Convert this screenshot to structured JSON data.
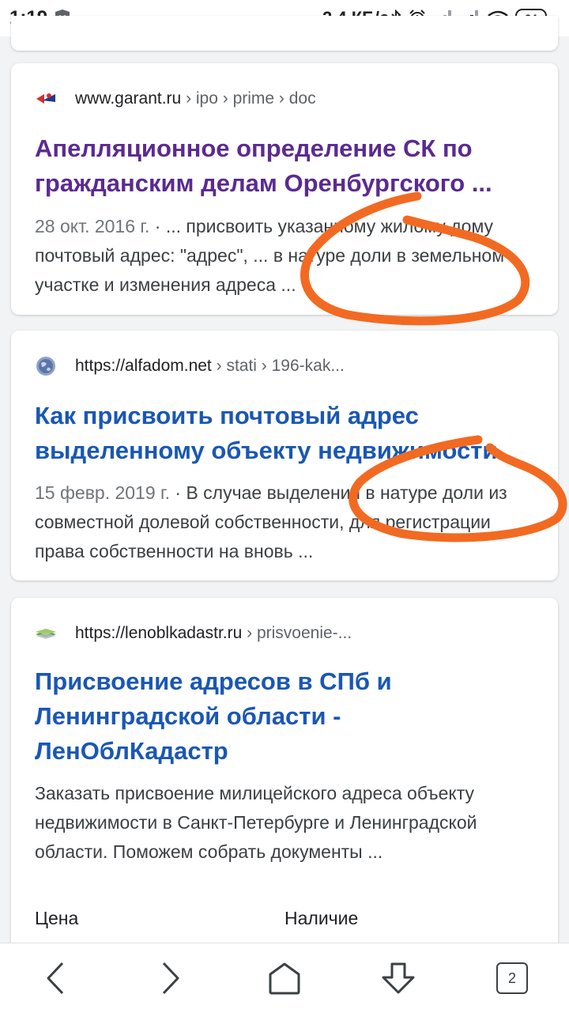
{
  "statusbar": {
    "time": "1:19",
    "net_speed": "2,4 КБ/с",
    "battery": "24",
    "icons": [
      "shield-icon",
      "bluetooth-icon",
      "alarm-icon",
      "signal-icon",
      "signal-icon",
      "wifi-icon",
      "battery-icon"
    ]
  },
  "results": [
    {
      "favicon": "garant-favicon",
      "site_url": "www.garant.ru",
      "site_path": " › ipo › prime › doc",
      "title": "Апелляционное определение СК по гражданским делам Оренбургского ...",
      "date": "28 окт. 2016 г.",
      "snippet": " · ... присвоить указанному жилому дому почтовый адрес: \"адрес\", ... в натуре доли в земельном участке и изменения адреса ..."
    },
    {
      "favicon": "globe-icon",
      "site_url": "https://alfadom.net",
      "site_path": " › stati › 196-kak...",
      "title": "Как присвоить почтовый адрес выделенному объекту недвижимости",
      "date": "15 февр. 2019 г.",
      "snippet": " · В случае выделения в натуре доли из совместной долевой собственности, для регистрации права собственности на вновь  ..."
    },
    {
      "favicon": "lenoblkadastr-favicon",
      "site_url": "https://lenoblkadastr.ru",
      "site_path": " › prisvoenie-...",
      "title": "Присвоение адресов в СПб и Ленинградской области - ЛенОблКадастр",
      "snippet": "Заказать присвоение милицейского адреса объекту недвижимости в Санкт-Петербурге и Ленинградской области. Поможем собрать документы ...",
      "attr_left": "Цена",
      "attr_right": "Наличие"
    }
  ],
  "navbar": {
    "buttons": [
      "back-icon",
      "forward-icon",
      "home-icon",
      "download-icon",
      "tabs-icon"
    ],
    "tab_count": "2"
  },
  "colors": {
    "visited_link": "#5b2a91",
    "link": "#1a57b5",
    "annotation": "#f26a21"
  }
}
